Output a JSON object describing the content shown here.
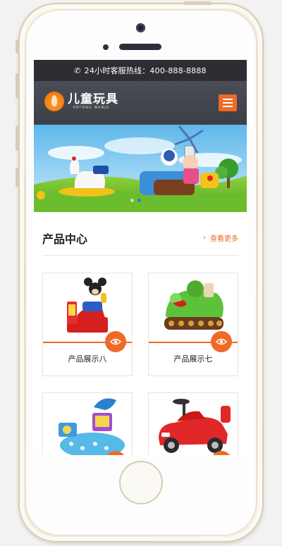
{
  "hotline": {
    "text": "24小时客服热线：400-888-8888",
    "icon": "phone-icon"
  },
  "header": {
    "logo_cn": "儿童玩具",
    "logo_en": "ERTONG WANJU",
    "menu_icon": "hamburger-menu-icon"
  },
  "banner": {
    "slides": 2,
    "active_slide": 2
  },
  "products": {
    "title": "产品中心",
    "more_label": "查看更多",
    "items": [
      {
        "name": "产品展示八"
      },
      {
        "name": "产品展示七"
      },
      {
        "name": ""
      },
      {
        "name": ""
      }
    ]
  },
  "colors": {
    "accent": "#ee6a26",
    "topbar": "#2c2e34",
    "header": "#45484f"
  }
}
